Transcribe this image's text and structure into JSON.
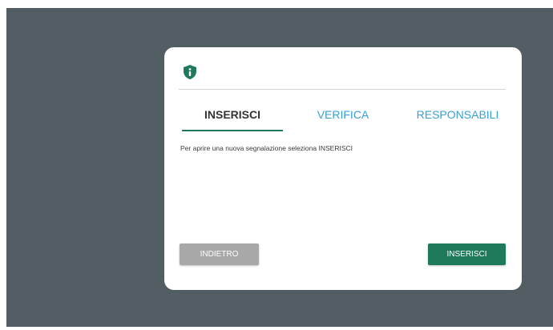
{
  "dialog": {
    "tabs": [
      {
        "label": "INSERISCI",
        "active": true
      },
      {
        "label": "VERIFICA",
        "active": false
      },
      {
        "label": "RESPONSABILI",
        "active": false
      }
    ],
    "message": "Per aprire una nuova segnalazione seleziona INSERISCI",
    "back_button_label": "INDIETRO",
    "insert_button_label": "INSERISCI"
  },
  "colors": {
    "backdrop": "#535e64",
    "accent_green": "#1e7a5a",
    "tab_inactive_blue": "#3aa0d0",
    "button_disabled_grey": "#a8a8a8"
  },
  "icons": {
    "header_icon": "shield-info-icon"
  }
}
